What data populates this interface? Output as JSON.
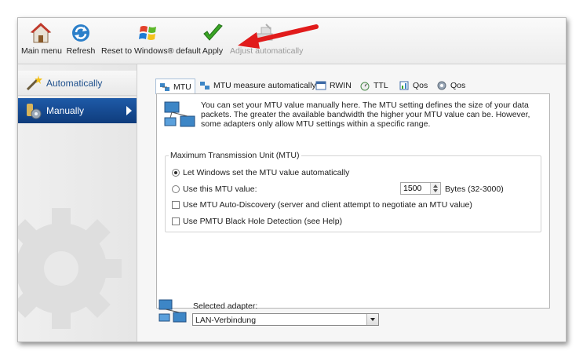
{
  "toolbar": {
    "main_menu": "Main menu",
    "refresh": "Refresh",
    "reset": "Reset to Windows® default",
    "apply": "Apply",
    "adjust": "Adjust automatically"
  },
  "sidebar": {
    "items": [
      {
        "label": "Automatically",
        "icon": "magic-wand-icon"
      },
      {
        "label": "Manually",
        "icon": "settings-icon"
      }
    ]
  },
  "tabs": [
    {
      "label": "MTU"
    },
    {
      "label": "MTU measure automatically"
    },
    {
      "label": "RWIN"
    },
    {
      "label": "TTL"
    },
    {
      "label": "Qos"
    },
    {
      "label": "Qos"
    }
  ],
  "info": {
    "text": "You can set your MTU value manually here. The MTU setting defines the size of your data packets. The greater the available bandwidth the higher your MTU value can be. However, some adapters only allow MTU settings within a specific range."
  },
  "group": {
    "title": "Maximum Transmission Unit (MTU)",
    "opt_auto": "Let Windows set the MTU value automatically",
    "opt_manual": "Use this MTU value:",
    "mtu_value": "1500",
    "bytes": "Bytes (32-3000)",
    "opt_discovery": "Use MTU Auto-Discovery (server and client attempt to negotiate an MTU value)",
    "opt_pmtu": "Use PMTU Black Hole Detection (see Help)"
  },
  "adapter": {
    "label": "Selected adapter:",
    "value": "LAN-Verbindung"
  },
  "colors": {
    "accent": "#1e5aa8",
    "arrow": "#e11b1b",
    "check": "#3aa524"
  }
}
